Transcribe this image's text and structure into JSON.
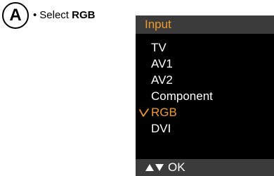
{
  "step": {
    "letter": "A"
  },
  "instruction": {
    "bullet": "•",
    "prefix": "Select",
    "emphasis": "RGB"
  },
  "menu": {
    "title": "Input",
    "items": [
      {
        "label": "TV",
        "selected": false
      },
      {
        "label": "AV1",
        "selected": false
      },
      {
        "label": "AV2",
        "selected": false
      },
      {
        "label": "Component",
        "selected": false
      },
      {
        "label": "RGB",
        "selected": true
      },
      {
        "label": "DVI",
        "selected": false
      }
    ],
    "footer": {
      "nav_icons": [
        "up-arrow-icon",
        "down-arrow-icon"
      ],
      "ok_label": "OK"
    }
  },
  "colors": {
    "accent": "#f19a2c",
    "menu_bg": "#000000",
    "bar_bg": "#3b3b3b",
    "text": "#ffffff"
  }
}
